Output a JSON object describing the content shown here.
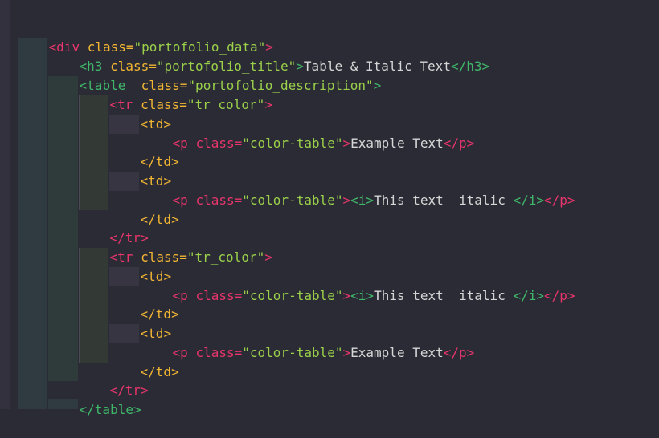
{
  "theme": {
    "background": "#2b2b35",
    "tag_red": "#e8356b",
    "tag_green": "#3fb86a",
    "tag_yellow": "#f2b632",
    "string": "#9bd14a",
    "text": "#d6d6d6"
  },
  "code": {
    "line1": [
      "<",
      "div",
      " ",
      "class",
      "=",
      "\"portofolio_data\"",
      ">"
    ],
    "line2": [
      "<",
      "h3",
      " ",
      "class",
      "=",
      "\"portofolio_title\"",
      ">",
      "Table & Italic Text",
      "</",
      "h3",
      ">"
    ],
    "line3": [
      "<",
      "table",
      "  ",
      "class",
      "=",
      "\"portofolio_description\"",
      ">"
    ],
    "line4": [
      "<",
      "tr",
      " ",
      "class",
      "=",
      "\"tr_color\"",
      ">"
    ],
    "line5": [
      "<",
      "td",
      ">"
    ],
    "line6": [
      "<",
      "p",
      " ",
      "class",
      "=",
      "\"color-table\"",
      ">",
      "Example Text",
      "</",
      "p",
      ">"
    ],
    "line7": [
      "</",
      "td",
      ">"
    ],
    "line8": [
      "<",
      "td",
      ">"
    ],
    "line9": [
      "<",
      "p",
      " ",
      "class",
      "=",
      "\"color-table\"",
      ">",
      "<",
      "i",
      ">",
      "This text  italic ",
      "</",
      "i",
      ">",
      "</",
      "p",
      ">"
    ],
    "line10": [
      "</",
      "td",
      ">"
    ],
    "line11": [
      "</",
      "tr",
      ">"
    ],
    "line12": [
      "<",
      "tr",
      " ",
      "class",
      "=",
      "\"tr_color\"",
      ">"
    ],
    "line13": [
      "<",
      "td",
      ">"
    ],
    "line14": [
      "<",
      "p",
      " ",
      "class",
      "=",
      "\"color-table\"",
      ">",
      "<",
      "i",
      ">",
      "This text  italic ",
      "</",
      "i",
      ">",
      "</",
      "p",
      ">"
    ],
    "line15": [
      "</",
      "td",
      ">"
    ],
    "line16": [
      "<",
      "td",
      ">"
    ],
    "line17": [
      "<",
      "p",
      " ",
      "class",
      "=",
      "\"color-table\"",
      ">",
      "Example Text",
      "</",
      "p",
      ">"
    ],
    "line18": [
      "</",
      "td",
      ">"
    ],
    "line19": [
      "</",
      "tr",
      ">"
    ],
    "line20": [
      "</",
      "table",
      ">"
    ]
  }
}
